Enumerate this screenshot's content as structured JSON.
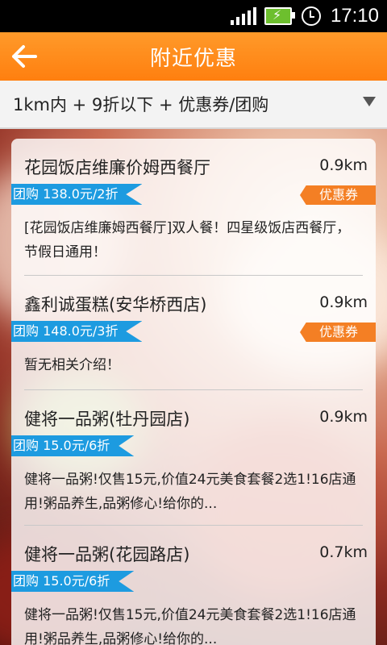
{
  "status": {
    "time": "17:10"
  },
  "header": {
    "title": "附近优惠"
  },
  "filter": {
    "text": "1km内 + 9折以下 + 优惠券/团购"
  },
  "list": {
    "items": [
      {
        "name": "花园饭店维廉价姆西餐厅",
        "distance": "0.9km",
        "group": "团购 138.0元/2折",
        "coupon": "优惠券",
        "desc": "[花园饭店维廉姆西餐厅]双人餐！四星级饭店西餐厅，节假日通用！"
      },
      {
        "name": "鑫利诚蛋糕(安华桥西店)",
        "distance": "0.9km",
        "group": "团购 148.0元/3折",
        "coupon": "优惠券",
        "desc": "暂无相关介绍！"
      },
      {
        "name": "健将一品粥(牡丹园店)",
        "distance": "0.9km",
        "group": "团购 15.0元/6折",
        "coupon": "",
        "desc": "健将一品粥!仅售15元,价值24元美食套餐2选1!16店通用!粥品养生,品粥修心!给你的..."
      },
      {
        "name": "健将一品粥(花园路店)",
        "distance": "0.7km",
        "group": "团购 15.0元/6折",
        "coupon": "",
        "desc": "健将一品粥!仅售15元,价值24元美食套餐2选1!16店通用!粥品养生,品粥修心!给你的..."
      }
    ]
  },
  "colors": {
    "accent": "#ff8a1a",
    "group_badge": "#1d9be0",
    "coupon_badge": "#f47f24"
  }
}
